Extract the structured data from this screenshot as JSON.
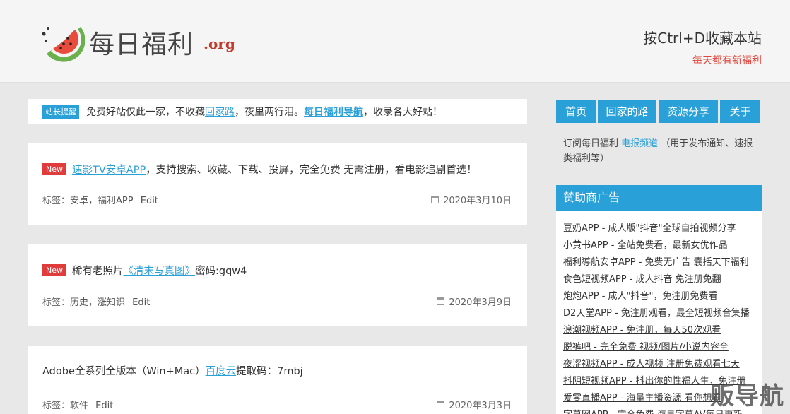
{
  "header": {
    "logo_text": "每日福利",
    "logo_org": ".org",
    "slogan_main": "按Ctrl+D收藏本站",
    "slogan_sub": "每天都有新福利"
  },
  "notice": {
    "tag": "站长提醒",
    "text1": "免费好站仅此一家，不收藏",
    "link1": "回家路",
    "text2": "，夜里两行泪。",
    "link2": "每日福利导航",
    "text3": "，收录各大好站！"
  },
  "posts": [
    {
      "badge": "New",
      "link": "速影TV安卓APP",
      "text": "，支持搜索、收藏、下载、投屏，完全免费 无需注册，看电影追剧首选！",
      "tags_label": "标签：",
      "tags": "安卓，福利APP",
      "edit": "Edit",
      "date": "2020年3月10日"
    },
    {
      "badge": "New",
      "text_before": "稀有老照片",
      "link": "《清末写真图》",
      "text": " 密码:gqw4",
      "tags_label": "标签：",
      "tags": "历史，涨知识",
      "edit": "Edit",
      "date": "2020年3月9日"
    },
    {
      "text_before": "Adobe全系列全版本（Win+Mac）",
      "link": "百度云",
      "text": " 提取码：7mbj",
      "tags_label": "标签：",
      "tags": "软件",
      "edit": "Edit",
      "date": "2020年3月3日"
    }
  ],
  "nav": [
    "首页",
    "回家的路",
    "资源分享",
    "关于"
  ],
  "subscribe": {
    "text1": "订阅每日福利 ",
    "link": "电报频道",
    "text2": " （用于发布通知、速报类福利等）"
  },
  "sponsor": {
    "title": "赞助商广告",
    "items": [
      "豆奶APP - 成人版\"抖音\"全球自拍视频分享",
      "小黄书APP - 全站免费看，最新女优作品",
      "福利導航安卓APP - 免费无广告 囊括天下福利",
      "食色短视频APP - 成人抖音 免注册免翻",
      "炮炮APP - 成人\"抖音\"，免注册免费看",
      "D2天堂APP - 免注册观看，最全短视频合集播",
      "浪潮视频APP - 免注册，每天50次观看",
      "脱裤吧 - 完全免费 视频/图片/小说内容全",
      "夜涩视频APP - 成人视频 注册免费观看七天",
      "抖阴短视频APP - 抖出你的性福人生，免注册",
      "爱零直播APP - 海量主播资源 看你想看",
      "字幕网APP - 完全免费 海量字幕AV每日更新"
    ]
  },
  "watermark": "贩导航",
  "colors": {
    "accent": "#2aa0d8",
    "new_badge": "#e03c3c",
    "slogan_sub": "#e0463c"
  }
}
